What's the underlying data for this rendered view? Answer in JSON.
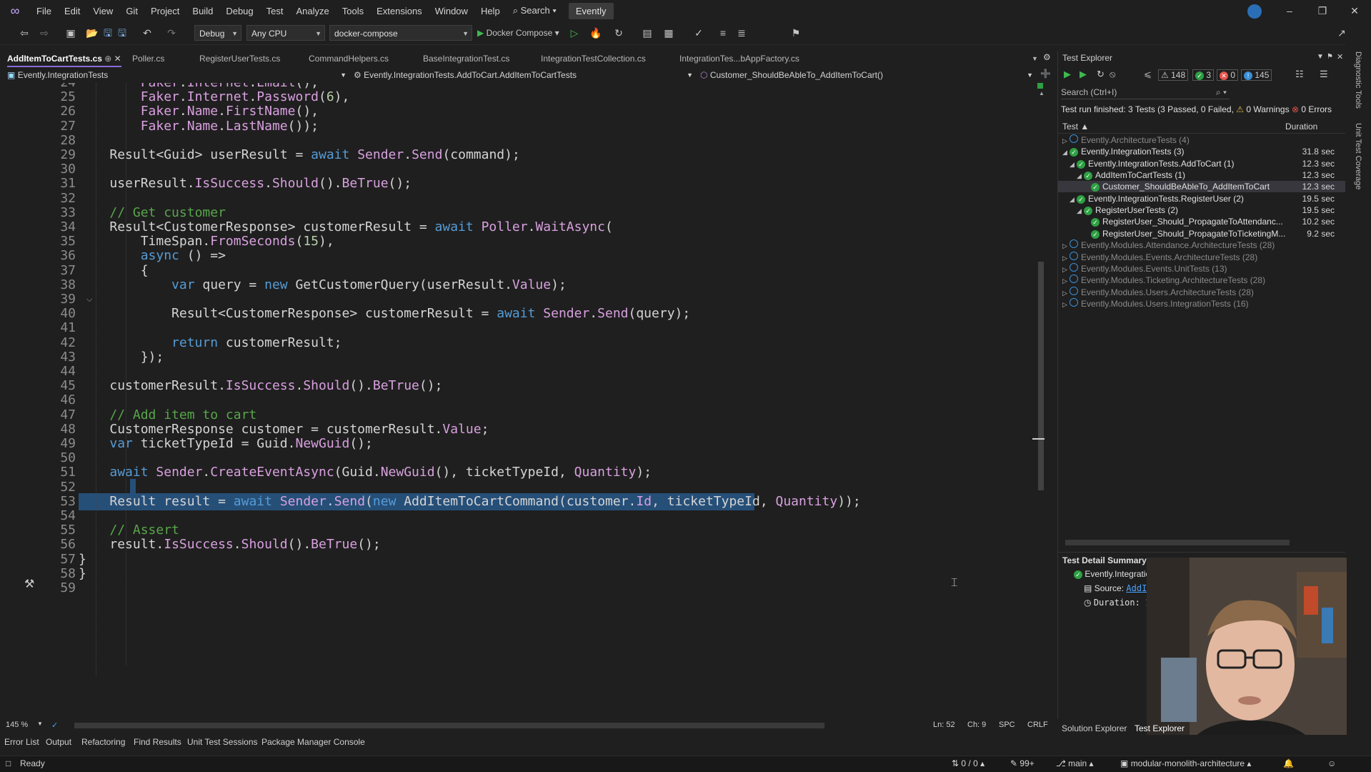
{
  "menubar": {
    "items": [
      "File",
      "Edit",
      "View",
      "Git",
      "Project",
      "Build",
      "Debug",
      "Test",
      "Analyze",
      "Tools",
      "Extensions",
      "Window",
      "Help"
    ],
    "search": "Search",
    "solution": "Evently"
  },
  "toolbar": {
    "config": "Debug",
    "platform": "Any CPU",
    "startup_project": "docker-compose",
    "run_label": "Docker Compose"
  },
  "tabs": [
    {
      "label": "AddItemToCartTests.cs",
      "active": true
    },
    {
      "label": "Poller.cs"
    },
    {
      "label": "RegisterUserTests.cs"
    },
    {
      "label": "CommandHelpers.cs"
    },
    {
      "label": "BaseIntegrationTest.cs"
    },
    {
      "label": "IntegrationTestCollection.cs"
    },
    {
      "label": "IntegrationTes...bAppFactory.cs"
    }
  ],
  "navbar": {
    "project": "Evently.IntegrationTests",
    "class": "Evently.IntegrationTests.AddToCart.AddItemToCartTests",
    "member": "Customer_ShouldBeAbleTo_AddItemToCart()"
  },
  "editor": {
    "lines": [
      {
        "n": "24",
        "code": "            Faker.Internet.Email(),"
      },
      {
        "n": "25",
        "code": "            Faker.Internet.Password(6),"
      },
      {
        "n": "26",
        "code": "            Faker.Name.FirstName(),"
      },
      {
        "n": "27",
        "code": "            Faker.Name.LastName());"
      },
      {
        "n": "28",
        "code": ""
      },
      {
        "n": "29",
        "code": "        Result<Guid> userResult = await Sender.Send(command);"
      },
      {
        "n": "30",
        "code": ""
      },
      {
        "n": "31",
        "code": "        userResult.IsSuccess.Should().BeTrue();"
      },
      {
        "n": "32",
        "code": ""
      },
      {
        "n": "33",
        "code": "        // Get customer"
      },
      {
        "n": "34",
        "code": "        Result<CustomerResponse> customerResult = await Poller.WaitAsync("
      },
      {
        "n": "35",
        "code": "            TimeSpan.FromSeconds(15),"
      },
      {
        "n": "36",
        "code": "            async () =>"
      },
      {
        "n": "37",
        "code": "            {"
      },
      {
        "n": "38",
        "code": "                var query = new GetCustomerQuery(userResult.Value);"
      },
      {
        "n": "39",
        "code": ""
      },
      {
        "n": "40",
        "code": "                Result<CustomerResponse> customerResult = await Sender.Send(query);"
      },
      {
        "n": "41",
        "code": ""
      },
      {
        "n": "42",
        "code": "                return customerResult;"
      },
      {
        "n": "43",
        "code": "            });"
      },
      {
        "n": "44",
        "code": ""
      },
      {
        "n": "45",
        "code": "        customerResult.IsSuccess.Should().BeTrue();"
      },
      {
        "n": "46",
        "code": ""
      },
      {
        "n": "47",
        "code": "        // Add item to cart"
      },
      {
        "n": "48",
        "code": "        CustomerResponse customer = customerResult.Value;"
      },
      {
        "n": "49",
        "code": "        var ticketTypeId = Guid.NewGuid();"
      },
      {
        "n": "50",
        "code": ""
      },
      {
        "n": "51",
        "code": "        await Sender.CreateEventAsync(Guid.NewGuid(), ticketTypeId, Quantity);"
      },
      {
        "n": "52",
        "code": ""
      },
      {
        "n": "53",
        "code": "        Result result = await Sender.Send(new AddItemToCartCommand(customer.Id, ticketTypeId, Quantity));"
      },
      {
        "n": "54",
        "code": ""
      },
      {
        "n": "55",
        "code": "        // Assert"
      },
      {
        "n": "56",
        "code": "        result.IsSuccess.Should().BeTrue();"
      },
      {
        "n": "57",
        "code": "    }"
      },
      {
        "n": "58",
        "code": "}"
      },
      {
        "n": "59",
        "code": ""
      }
    ],
    "zoom": "145 %",
    "cursor_line": "Ln: 52",
    "cursor_col": "Ch: 9",
    "whitespace": "SPC",
    "line_ending": "CRLF"
  },
  "test_explorer": {
    "title": "Test Explorer",
    "count_total": "148",
    "count_passed": "3",
    "count_failed": "0",
    "count_notrun": "145",
    "search_placeholder": "Search (Ctrl+I)",
    "summary": "Test run finished: 3 Tests (3 Passed, 0 Failed,",
    "warnings": "0 Warnings",
    "errors": "0 Errors",
    "col_test": "Test",
    "col_duration": "Duration",
    "rows": [
      {
        "label": "Evently.ArchitectureTests (4)",
        "indent": 0,
        "state": "notrun",
        "expanded": false,
        "dur": ""
      },
      {
        "label": "Evently.IntegrationTests (3)",
        "indent": 0,
        "state": "ok",
        "expanded": true,
        "dur": "31.8 sec"
      },
      {
        "label": "Evently.IntegrationTests.AddToCart (1)",
        "indent": 1,
        "state": "ok",
        "expanded": true,
        "dur": "12.3 sec"
      },
      {
        "label": "AddItemToCartTests (1)",
        "indent": 2,
        "state": "ok",
        "expanded": true,
        "dur": "12.3 sec"
      },
      {
        "label": "Customer_ShouldBeAbleTo_AddItemToCart",
        "indent": 3,
        "state": "ok",
        "leaf": true,
        "selected": true,
        "dur": "12.3 sec"
      },
      {
        "label": "Evently.IntegrationTests.RegisterUser (2)",
        "indent": 1,
        "state": "ok",
        "expanded": true,
        "dur": "19.5 sec"
      },
      {
        "label": "RegisterUserTests (2)",
        "indent": 2,
        "state": "ok",
        "expanded": true,
        "dur": "19.5 sec"
      },
      {
        "label": "RegisterUser_Should_PropagateToAttendanc...",
        "indent": 3,
        "state": "ok",
        "leaf": true,
        "dur": "10.2 sec"
      },
      {
        "label": "RegisterUser_Should_PropagateToTicketingM...",
        "indent": 3,
        "state": "ok",
        "leaf": true,
        "dur": "9.2 sec"
      },
      {
        "label": "Evently.Modules.Attendance.ArchitectureTests (28)",
        "indent": 0,
        "state": "notrun",
        "expanded": false,
        "dur": ""
      },
      {
        "label": "Evently.Modules.Events.ArchitectureTests (28)",
        "indent": 0,
        "state": "notrun",
        "expanded": false,
        "dur": ""
      },
      {
        "label": "Evently.Modules.Events.UnitTests (13)",
        "indent": 0,
        "state": "notrun",
        "expanded": false,
        "dur": ""
      },
      {
        "label": "Evently.Modules.Ticketing.ArchitectureTests (28)",
        "indent": 0,
        "state": "notrun",
        "expanded": false,
        "dur": ""
      },
      {
        "label": "Evently.Modules.Users.ArchitectureTests (28)",
        "indent": 0,
        "state": "notrun",
        "expanded": false,
        "dur": ""
      },
      {
        "label": "Evently.Modules.Users.IntegrationTests (16)",
        "indent": 0,
        "state": "notrun",
        "expanded": false,
        "dur": ""
      }
    ],
    "detail_title": "Test Detail Summary",
    "detail_name": "Evently.IntegrationTests.Ad",
    "detail_source_label": "Source:",
    "detail_source": "AddItemT",
    "detail_duration": "Duration: 12.3"
  },
  "right_strip": {
    "diag": "Diagnostic Tools",
    "cov": "Unit Test Coverage"
  },
  "bottom_tabs": [
    "Error List",
    "Output",
    "Refactoring",
    "Find Results",
    "Unit Test Sessions",
    "Package Manager Console"
  ],
  "side_tabs": [
    "Solution Explorer",
    "Test Explorer"
  ],
  "status": {
    "ready": "Ready",
    "changes": "0 / 0",
    "edits": "99+",
    "branch": "main",
    "repo": "modular-monolith-architecture"
  },
  "colors": {
    "accent": "#8a6cd6",
    "selection": "#264f78",
    "pass": "#2ea043",
    "notrun": "#3a8fd6"
  }
}
